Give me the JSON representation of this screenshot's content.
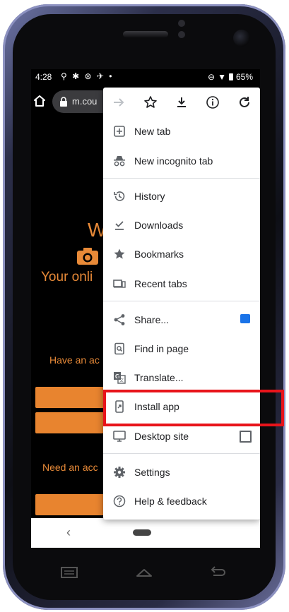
{
  "status_bar": {
    "time": "4:28",
    "battery": "65%"
  },
  "browser": {
    "url": "m.cou"
  },
  "page": {
    "headline": "W",
    "tagline": "Your onli",
    "have_account": "Have an ac",
    "need_account": "Need an acc"
  },
  "menu": {
    "items": [
      {
        "label": "New tab"
      },
      {
        "label": "New incognito tab"
      },
      {
        "label": "History"
      },
      {
        "label": "Downloads"
      },
      {
        "label": "Bookmarks"
      },
      {
        "label": "Recent tabs"
      },
      {
        "label": "Share..."
      },
      {
        "label": "Find in page"
      },
      {
        "label": "Translate..."
      },
      {
        "label": "Install app"
      },
      {
        "label": "Desktop site"
      },
      {
        "label": "Settings"
      },
      {
        "label": "Help & feedback"
      }
    ]
  },
  "nav": {
    "back": "‹"
  },
  "colors": {
    "accent": "#e88a38",
    "highlight": "#e8141b",
    "share_badge": "#1a73e8"
  }
}
